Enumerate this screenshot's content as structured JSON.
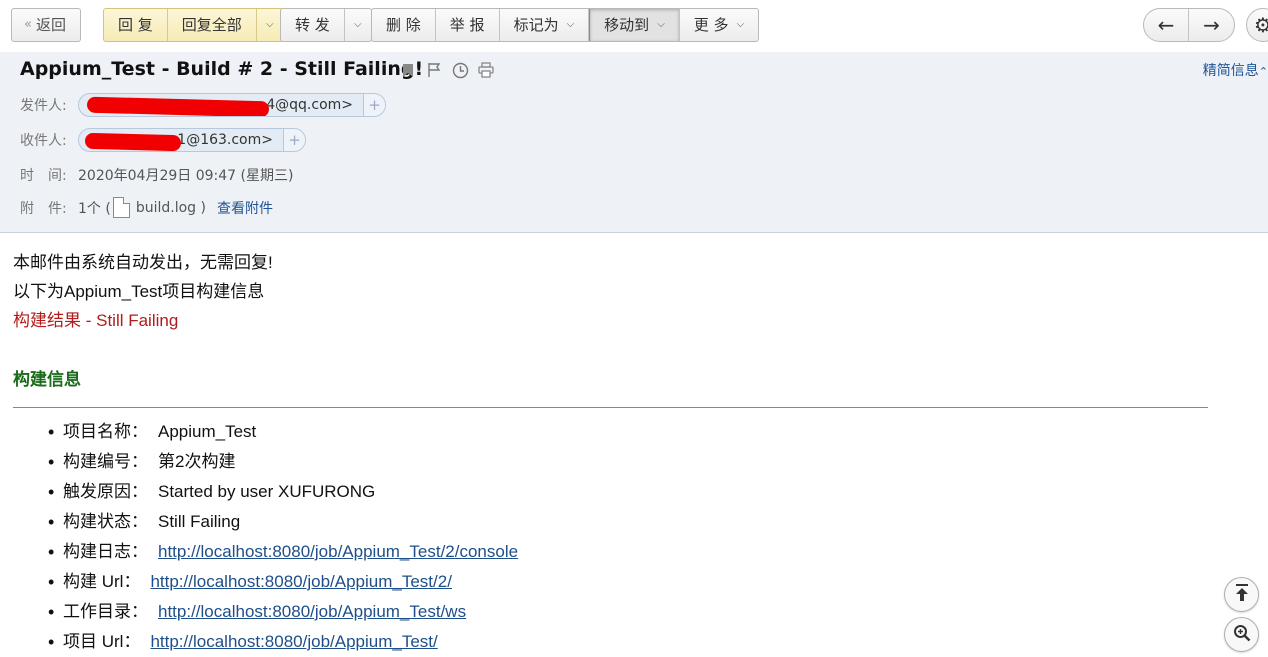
{
  "toolbar": {
    "back": "返回",
    "reply": "回 复",
    "reply_all": "回复全部",
    "forward": "转 发",
    "delete": "删 除",
    "report": "举 报",
    "mark_as": "标记为",
    "move_to": "移动到",
    "more": "更 多"
  },
  "mail": {
    "subject": "Appium_Test - Build # 2 - Still Failing!",
    "brief_info": "精简信息",
    "from_label": "发件人:",
    "from_addr": "4@qq.com>",
    "to_label": "收件人:",
    "to_addr": "1@163.com>",
    "time_label": "时　间:",
    "time_value": "2020年04月29日 09:47 (星期三)",
    "attach_label": "附　件:",
    "attach_count": "1个 (",
    "attach_name": "build.log )",
    "view_attach": "查看附件"
  },
  "body": {
    "line1": "本邮件由系统自动发出，无需回复!",
    "line2": "以下为Appium_Test项目构建信息",
    "result": "构建结果 - Still Failing",
    "section_title": "构建信息",
    "items": [
      {
        "key": "项目名称：",
        "value": "Appium_Test"
      },
      {
        "key": "构建编号：",
        "value": "第2次构建"
      },
      {
        "key": "触发原因：",
        "value": "Started by user XUFURONG"
      },
      {
        "key": "构建状态：",
        "value": "Still Failing"
      },
      {
        "key": "构建日志：",
        "value": "http://localhost:8080/job/Appium_Test/2/console"
      },
      {
        "key": "构建 Url：",
        "value": "http://localhost:8080/job/Appium_Test/2/"
      },
      {
        "key": "工作目录：",
        "value": "http://localhost:8080/job/Appium_Test/ws"
      },
      {
        "key": "项目 Url：",
        "value": "http://localhost:8080/job/Appium_Test/"
      }
    ]
  },
  "icons": {
    "back": "double-chevron-left-icon",
    "prev": "arrow-left-icon",
    "next": "arrow-right-icon",
    "settings": "gear-icon",
    "bookmark": "bookmark-icon",
    "flag": "flag-icon",
    "clock": "clock-icon",
    "print": "print-icon",
    "to_top": "scroll-top-icon",
    "zoom": "zoom-icon"
  },
  "colors": {
    "result_red": "#b21b1b",
    "section_green": "#1a6b1a",
    "link_blue": "#1f4f8a",
    "header_bg": "#eef1f6"
  }
}
